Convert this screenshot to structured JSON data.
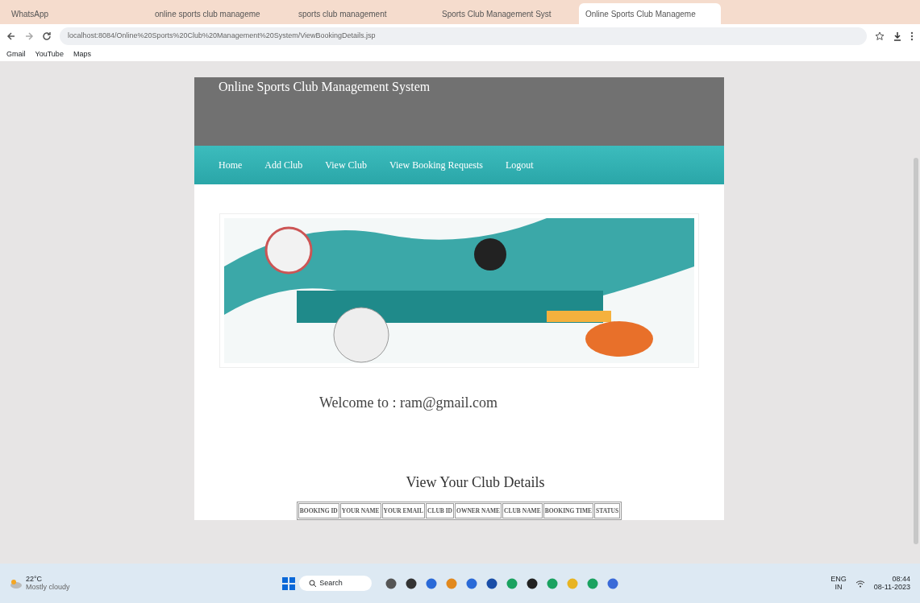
{
  "browser": {
    "tabs": [
      {
        "title": "WhatsApp",
        "selected": false
      },
      {
        "title": "online sports club manageme",
        "selected": false
      },
      {
        "title": "sports club management",
        "selected": false
      },
      {
        "title": "Sports Club Management Syst",
        "selected": false
      },
      {
        "title": "Online Sports Club Manageme",
        "selected": true
      }
    ],
    "address": "localhost:8084/Online%20Sports%20Club%20Management%20System/ViewBookingDetails.jsp",
    "bookmarks": [
      "Gmail",
      "YouTube",
      "Maps"
    ]
  },
  "site": {
    "title": "Online Sports Club Management System",
    "nav": [
      "Home",
      "Add Club",
      "View Club",
      "View Booking Requests",
      "Logout"
    ],
    "welcome": "Welcome to : ram@gmail.com",
    "heading": "View Your Club Details",
    "table": {
      "columns": [
        "BOOKING ID",
        "YOUR NAME",
        "YOUR EMAIL",
        "CLUB ID",
        "OWNER NAME",
        "CLUB NAME",
        "BOOKING TIME",
        "STATUS"
      ]
    }
  },
  "taskbar": {
    "weather_temp": "22°C",
    "weather_text": "Mostly cloudy",
    "search": "Search",
    "lang": "ENG",
    "region": "IN",
    "time": "08:44",
    "date": "08-11-2023"
  }
}
